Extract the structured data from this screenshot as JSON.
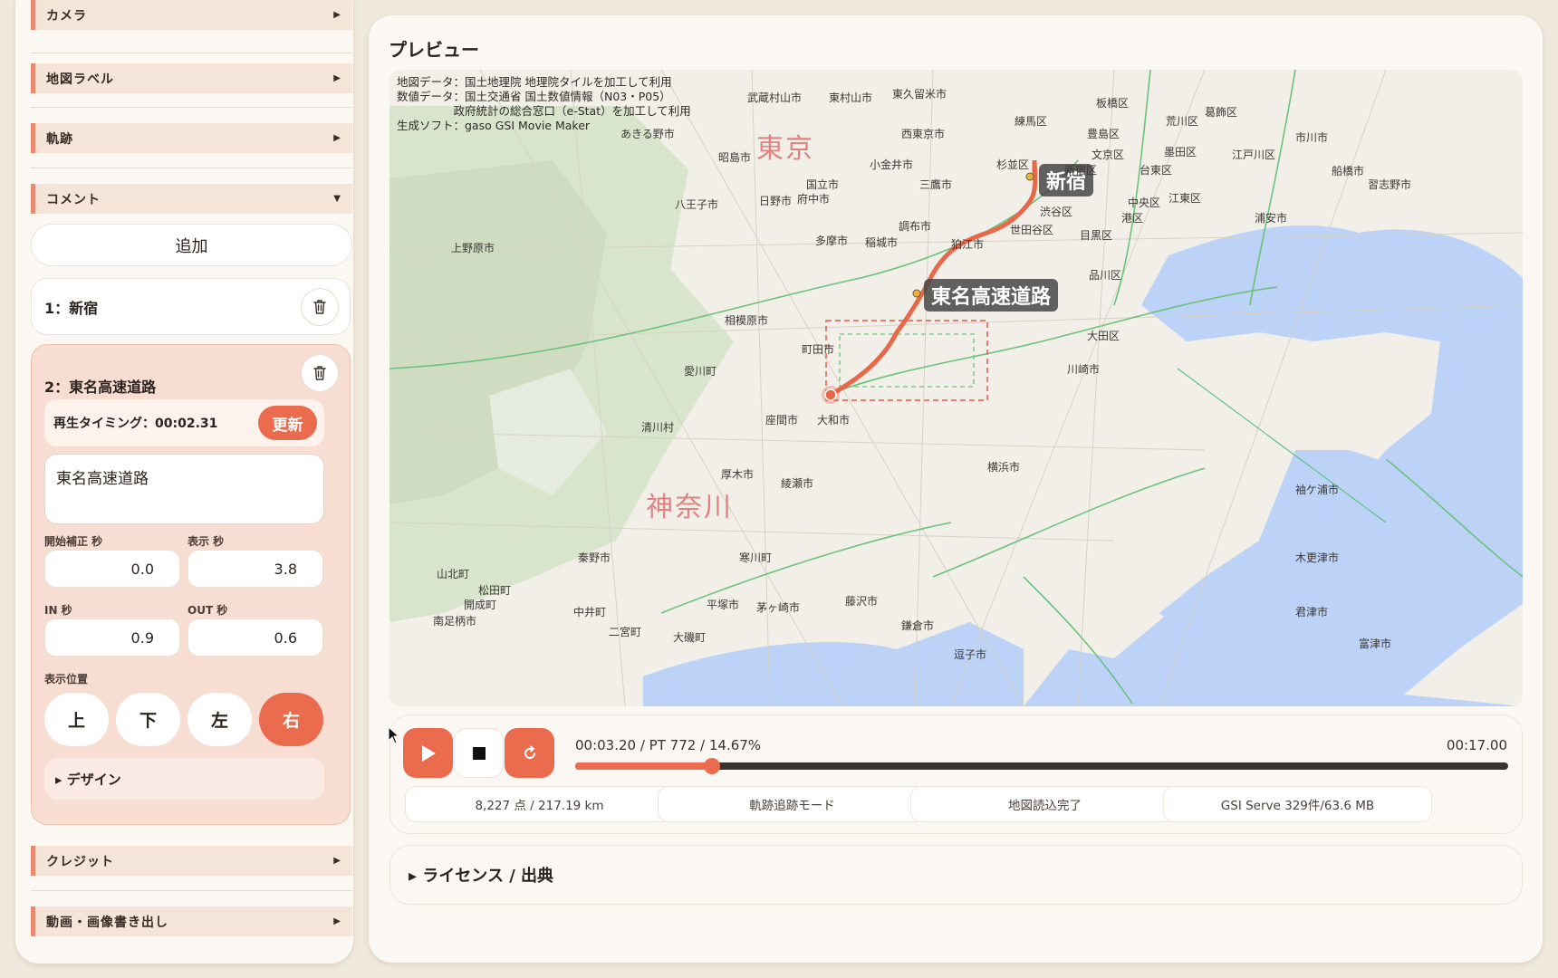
{
  "sidebar": {
    "sections": {
      "camera": "カメラ",
      "map_labels": "地図ラベル",
      "track": "軌跡",
      "comment": "コメント",
      "credit": "クレジット",
      "export": "動画・画像書き出し"
    },
    "add_label": "追加",
    "comments": [
      {
        "label": "1：新宿"
      },
      {
        "label": "2：東名高速道路"
      }
    ],
    "active_comment": {
      "timing_label": "再生タイミング：00:02.31",
      "update_label": "更新",
      "text": "東名高速道路",
      "start_offset_label": "開始補正 秒",
      "start_offset": "0.0",
      "display_label": "表示 秒",
      "display": "3.8",
      "in_label": "IN 秒",
      "in": "0.9",
      "out_label": "OUT 秒",
      "out": "0.6",
      "position_label": "表示位置",
      "positions": [
        "上",
        "下",
        "左",
        "右"
      ],
      "selected_position": "右",
      "design_label": "▸ デザイン"
    }
  },
  "preview": {
    "title": "プレビュー",
    "attribution": "地図データ：国土地理院 地理院タイルを加工して利用\n数値データ：国土交通省 国土数値情報（N03・P05）\n　　　　　政府統計の総合窓口（e-Stat）を加工して利用\n生成ソフト：gaso GSI Movie Maker",
    "route_labels": {
      "start": "新宿",
      "waypoint": "東名高速道路"
    },
    "prefectures": {
      "tokyo": "東京",
      "kanagawa": "神奈川"
    },
    "places": [
      "武蔵村山市",
      "東村山市",
      "東久留米市",
      "板橋区",
      "葛飾区",
      "荒川区",
      "練馬区",
      "豊島区",
      "西東京市",
      "文京区",
      "墨田区",
      "江戸川区",
      "市川市",
      "昭島市",
      "小金井市",
      "杉並区",
      "新宿区",
      "台東区",
      "船橋市",
      "国立市",
      "府中市",
      "三鷹市",
      "中央区",
      "江東区",
      "習志野市",
      "八王子市",
      "日野市",
      "渋谷区",
      "港区",
      "浦安市",
      "調布市",
      "世田谷区",
      "目黒区",
      "多摩市",
      "稲城市",
      "狛江市",
      "上野原市",
      "品川区",
      "相模原市",
      "大田区",
      "町田市",
      "愛川町",
      "川崎市",
      "清川村",
      "座間市",
      "大和市",
      "厚木市",
      "綾瀬市",
      "横浜市",
      "袖ケ浦市",
      "秦野市",
      "寒川町",
      "木更津市",
      "山北町",
      "松田町",
      "開成町",
      "中井町",
      "平塚市",
      "茅ヶ崎市",
      "藤沢市",
      "君津市",
      "南足柄市",
      "鎌倉市",
      "二宮町",
      "大磯町",
      "富津市",
      "あきる野市",
      "逗子市"
    ]
  },
  "controls": {
    "current_time": "00:03.20 / PT 772 / 14.67%",
    "total_time": "00:17.00",
    "progress": 0.1467,
    "stats": [
      "8,227 点 / 217.19 km",
      "軌跡追跡モード",
      "地図読込完了",
      "GSI Serve 329件/63.6 MB"
    ]
  },
  "license": "▸ ライセンス / 出典",
  "colors": {
    "accent": "#eb6b4e",
    "route": "#e8684a",
    "sea": "#bcd2f7"
  }
}
